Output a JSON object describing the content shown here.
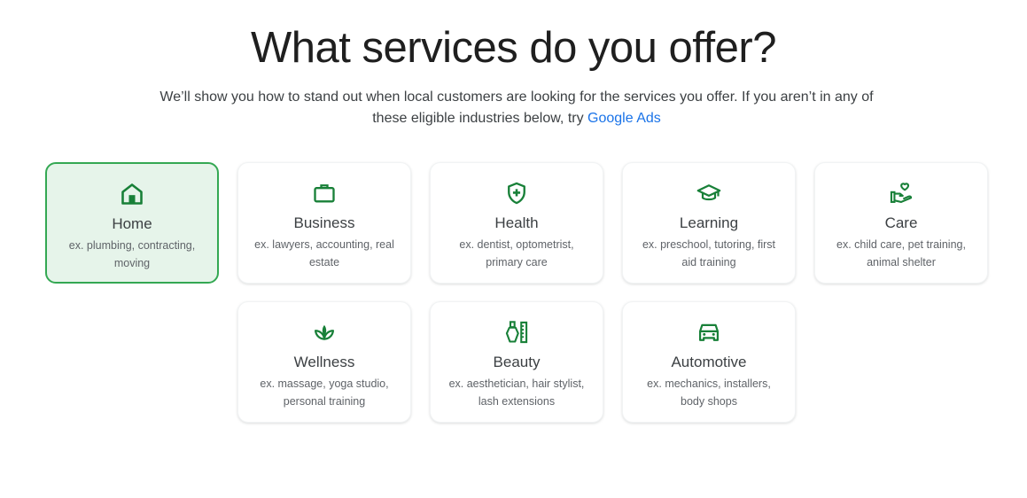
{
  "header": {
    "title": "What services do you offer?",
    "subtitle_text": "We’ll show you how to stand out when local customers are looking for the services you offer. If you aren’t in any of these eligible industries below, try ",
    "subtitle_link": "Google Ads"
  },
  "colors": {
    "accent_green": "#188038",
    "selected_bg": "#e6f4ea",
    "selected_border": "#34a853",
    "link_blue": "#1a73e8"
  },
  "categories": [
    {
      "icon": "house-icon",
      "title": "Home",
      "desc": "ex. plumbing, contracting, moving",
      "selected": true
    },
    {
      "icon": "briefcase-icon",
      "title": "Business",
      "desc": "ex. lawyers, accounting, real estate",
      "selected": false
    },
    {
      "icon": "shield-plus-icon",
      "title": "Health",
      "desc": "ex. dentist, optometrist, primary care",
      "selected": false
    },
    {
      "icon": "graduation-cap-icon",
      "title": "Learning",
      "desc": "ex. preschool, tutoring, first aid training",
      "selected": false
    },
    {
      "icon": "hand-heart-icon",
      "title": "Care",
      "desc": "ex. child care, pet training, animal shelter",
      "selected": false
    },
    {
      "icon": "spa-icon",
      "title": "Wellness",
      "desc": "ex. massage, yoga studio, personal training",
      "selected": false
    },
    {
      "icon": "nail-polish-icon",
      "title": "Beauty",
      "desc": "ex. aesthetician, hair stylist, lash extensions",
      "selected": false
    },
    {
      "icon": "car-icon",
      "title": "Automotive",
      "desc": "ex. mechanics, installers, body shops",
      "selected": false
    }
  ]
}
